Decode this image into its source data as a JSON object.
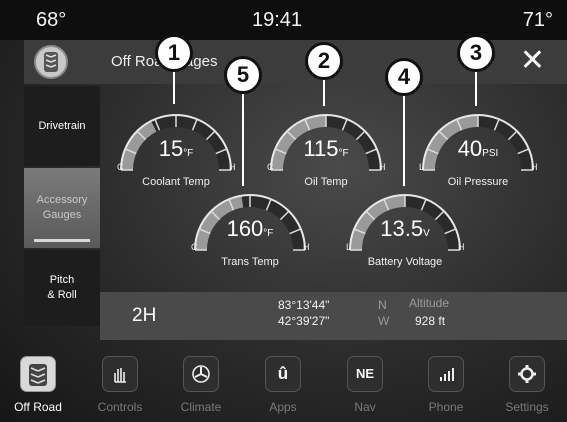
{
  "status": {
    "temp_left": "68°",
    "time": "19:41",
    "temp_right": "71°"
  },
  "header": {
    "title": "Off Road Pages",
    "close_label": "✕"
  },
  "sidebar": {
    "items": [
      {
        "label_1": "Drivetrain",
        "label_2": ""
      },
      {
        "label_1": "Accessory",
        "label_2": "Gauges"
      },
      {
        "label_1": "Pitch",
        "label_2": "& Roll"
      }
    ]
  },
  "gauges": {
    "coolant": {
      "value": "15",
      "unit": "°F",
      "label": "Coolant Temp",
      "low": "C",
      "high": "H",
      "level": 0.35,
      "marker": "1"
    },
    "oil_temp": {
      "value": "115",
      "unit": "°F",
      "label": "Oil Temp",
      "low": "C",
      "high": "H",
      "level": 0.5,
      "marker": "2"
    },
    "oil_pressure": {
      "value": "40",
      "unit": "PSI",
      "label": "Oil Pressure",
      "low": "L",
      "high": "H",
      "level": 0.5,
      "marker": "3"
    },
    "battery": {
      "value": "13.5",
      "unit": "V",
      "label": "Battery Voltage",
      "low": "L",
      "high": "H",
      "level": 0.5,
      "marker": "4"
    },
    "trans": {
      "value": "160",
      "unit": "°F",
      "label": "Trans Temp",
      "low": "C",
      "high": "H",
      "level": 0.45,
      "marker": "5"
    }
  },
  "info": {
    "drive_mode": "2H",
    "latitude": "83°13'44\"",
    "lat_dir": "N",
    "longitude": "42°39'27\"",
    "lon_dir": "W",
    "altitude_label": "Altitude",
    "altitude_value": "928 ft"
  },
  "nav": {
    "items": [
      {
        "label": "Off Road",
        "icon": "tire-icon",
        "active": true
      },
      {
        "label": "Controls",
        "icon": "hand-icon",
        "active": false
      },
      {
        "label": "Climate",
        "icon": "fan-icon",
        "active": false
      },
      {
        "label": "Apps",
        "icon": "apps-icon",
        "glyph": "û",
        "active": false
      },
      {
        "label": "Nav",
        "icon": "compass-icon",
        "glyph": "NE",
        "active": false
      },
      {
        "label": "Phone",
        "icon": "phone-signal-icon",
        "active": false
      },
      {
        "label": "Settings",
        "icon": "gear-icon",
        "active": false
      }
    ]
  }
}
